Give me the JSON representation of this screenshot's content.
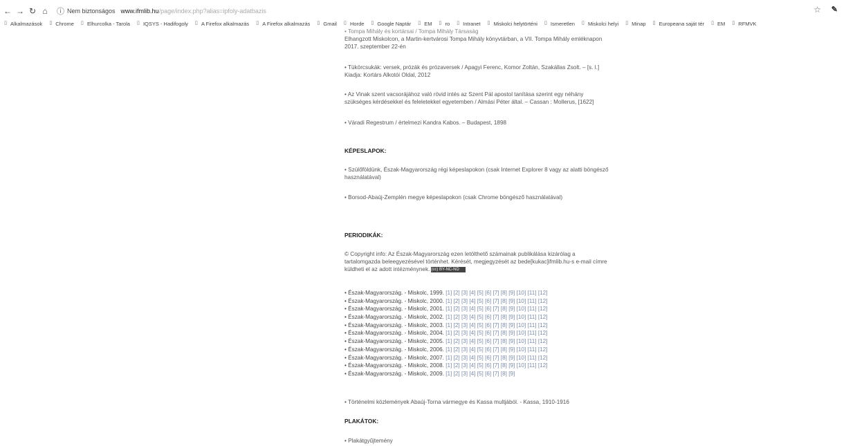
{
  "browser": {
    "security_label": "Nem biztonságos",
    "url_host": "www.ifmlib.hu",
    "url_path": "/page/index.php?alias=ipfoly-adatbazis",
    "bookmarks": [
      "Alkalmazások",
      "Chrome",
      "Elhurcolka - Tarola",
      "IQSYS - Hadifogoly",
      "A Firefox alkalmazás",
      "A Firefox alkalmazás",
      "Gmail",
      "Horde",
      "Google Naptár",
      "EM",
      "ro",
      "Intranet",
      "Miskolci helytörténi",
      "Ismeretlen",
      "Miskolci helyi",
      "Minap",
      "Europeana saját tér",
      "EM",
      "RFMVK"
    ]
  },
  "content": {
    "top_partial": "• Tompa Mihály és kortársai / Tompa Mihály Társaság",
    "item1_line1": "Elhangzott Miskolcon, a Martin-kertvárosi Tompa Mihály könyvtárban, a VII. Tompa Mihály emléknapon",
    "item1_line2": "2017. szeptember 22-én",
    "item2_line1": "• Tükörcsukák: versek, prózák és prózaversek / Apagyi Ferenc, Komor Zoltán, Szakállas Zsolt. – [s. l.]",
    "item2_line2": "Kiadja: Kortárs Alkotói Oldal, 2012",
    "item3_line1": "• Az Vinak szent vacsorájához való rövid intés az Szent Pál apostol tanítása szerint egy néhány",
    "item3_line2": "szükséges kérdésekkel és feleletekkel egyetemben / Almási Péter által. – Cassan : Mollerus, [1622]",
    "item4": "• Váradi Regestrum / értelmezi Kandra Kabos. – Budapest, 1898",
    "heading_postcards": "KÉPESLAPOK:",
    "postcard1_line1": "• Szülőföldünk, Észak-Magyarország régi képeslapokon (csak Internet Explorer 8 vagy az alatti böngésző",
    "postcard1_line2": "használatával)",
    "postcard2": "• Borsod-Abaúj-Zemplén megye képeslapokon (csak Chrome böngésző használatával)",
    "heading_periodicals": "PERIODIKÁK:",
    "copyright_line1": "© Copyright info: Az Észak-Magyarország ezen letölthető számainak publikálása kizárólag a",
    "copyright_line2": "tartalomgazda beleegyezésével történhet. Kérését, megjegyzését az bede[kukac]ifmlib.hu-s e-mail címre",
    "copyright_line3": "küldheti el az adott intézménynek.",
    "cc_badge": "(cc) BY-NC-ND",
    "periodicals": [
      {
        "label": "• Észak-Magyarország. - Miskolc, 1999.",
        "links": "[1] [2] [3] [4] [5] [6] [7] [8] [9] [10] [11] [12]"
      },
      {
        "label": "• Észak-Magyarország. - Miskolc, 2000.",
        "links": "[1] [2] [3] [4] [5] [6] [7] [8] [9] [10] [11] [12]"
      },
      {
        "label": "• Észak-Magyarország. - Miskolc, 2001.",
        "links": "[1] [2] [3] [4] [5] [6] [7] [8] [9] [10] [11] [12]"
      },
      {
        "label": "• Észak-Magyarország. - Miskolc, 2002.",
        "links": "[1] [2] [3] [4] [5] [6] [7] [8] [9] [10] [11] [12]"
      },
      {
        "label": "• Észak-Magyarország. - Miskolc, 2003.",
        "links": "[1] [2] [3] [4] [5] [6] [7] [8] [9] [10] [11] [12]"
      },
      {
        "label": "• Észak-Magyarország. - Miskolc, 2004.",
        "links": "[1] [2] [3] [4] [5] [6] [7] [8] [9] [10] [11] [12]"
      },
      {
        "label": "• Észak-Magyarország. - Miskolc, 2005.",
        "links": "[1] [2] [3] [4] [5] [6] [7] [8] [9] [10] [11] [12]"
      },
      {
        "label": "• Észak-Magyarország. - Miskolc, 2006.",
        "links": "[1] [2] [3] [4] [5] [6] [7] [8] [9] [10] [11] [12]"
      },
      {
        "label": "• Észak-Magyarország. - Miskolc, 2007.",
        "links": "[1] [2] [3] [4] [5] [6] [7] [8] [9] [10] [11] [12]"
      },
      {
        "label": "• Észak-Magyarország. - Miskolc, 2008.",
        "links": "[1] [2] [3] [4] [5] [6] [7] [8] [9] [10] [11] [12]"
      },
      {
        "label": "• Észak-Magyarország. - Miskolc, 2009.",
        "links": "[1] [2] [3] [4] [5] [6] [7] [8] [9]"
      }
    ],
    "historical": "• Történelmi közlemények Abaúj-Torna vármegye és Kassa multjából. - Kassa, 1910-1916",
    "heading_posters": "PLAKÁTOK:",
    "posters": "• Plakátgyűjtemény"
  }
}
